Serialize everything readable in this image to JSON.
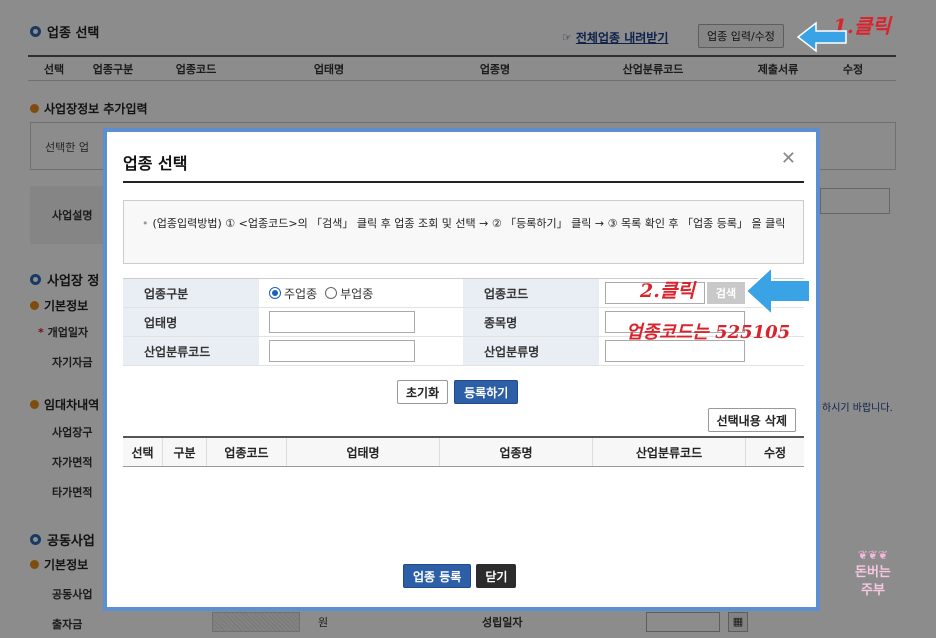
{
  "background": {
    "section_title": "업종 선택",
    "download_link": "전체업종 내려받기",
    "input_edit_button": "업종 입력/수정",
    "table_headers": [
      "선택",
      "업종구분",
      "업종코드",
      "업태명",
      "업종명",
      "산업분류코드",
      "제출서류",
      "수정"
    ],
    "extra_info_title": "사업장정보 추가입력",
    "extra_info_text": "선택한 업",
    "business_desc_label": "사업설명",
    "business_section_title": "사업장 정",
    "basic_info_title": "기본정보",
    "open_date_label": "개업일자",
    "own_capital_label": "자기자금",
    "lease_title": "임대차내역",
    "lease_note": "하시기 바랍니다.",
    "lease_rows": [
      "사업장구",
      "자가면적",
      "타가면적"
    ],
    "joint_title": "공동사업",
    "joint_basic_title": "기본정보",
    "joint_rows": [
      "공동사업",
      "출자금"
    ],
    "won_unit": "원",
    "established_date_label": "성립일자",
    "watermark_line1": "돈버는",
    "watermark_line2": "주부"
  },
  "modal": {
    "title": "업종 선택",
    "notice": "(업종입력방법) ① <업종코드>의 「검색」 클릭 후 업종 조회 및 선택 → ② 「등록하기」 클릭 → ③ 목록 확인 후 「업종 등록」 을 클릭",
    "form": {
      "type_label": "업종구분",
      "radio_main": "주업종",
      "radio_sub": "부업종",
      "code_label": "업종코드",
      "search_button": "검색",
      "biz_name_label": "업태명",
      "item_name_label": "종목명",
      "industry_code_label": "산업분류코드",
      "industry_name_label": "산업분류명"
    },
    "reset_button": "초기화",
    "register_button": "등록하기",
    "delete_selected_button": "선택내용 삭제",
    "table_headers": [
      "선택",
      "구분",
      "업종코드",
      "업태명",
      "업종명",
      "산업분류코드",
      "수정"
    ],
    "submit_button": "업종 등록",
    "close_button": "닫기"
  },
  "annotations": {
    "step1": "1.클릭",
    "step2": "2.클릭",
    "code_hint": "업종코드는 525105"
  },
  "colors": {
    "modal_border": "#5b8fd0",
    "primary_button": "#2d5fa8",
    "annotation_red": "#d9232d",
    "arrow_blue": "#3aa3e6"
  }
}
